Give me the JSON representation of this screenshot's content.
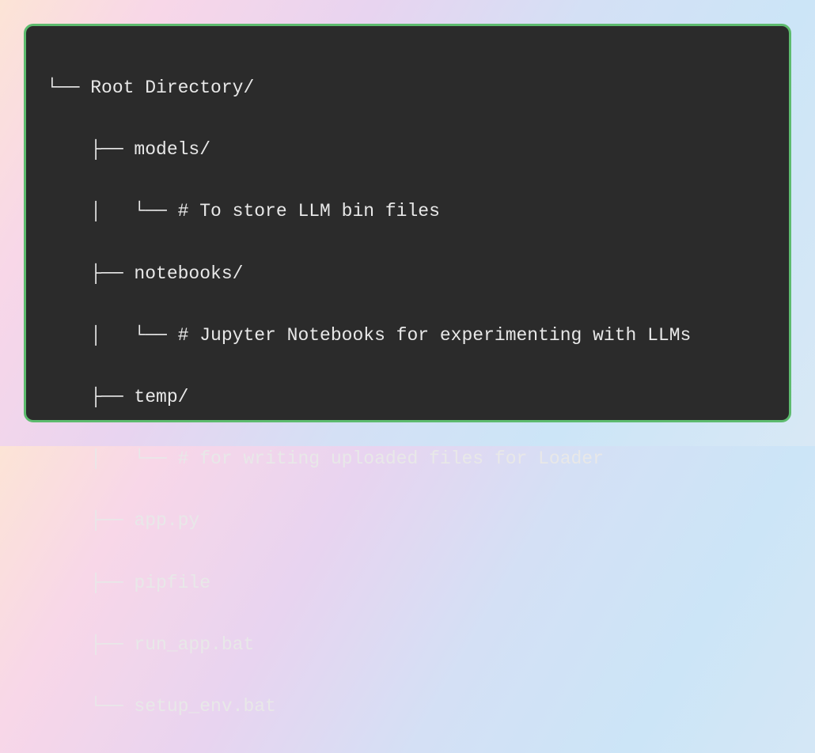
{
  "tree": {
    "lines": [
      "└── Root Directory/",
      "    ├── models/",
      "    │   └── # To store LLM bin files",
      "    ├── notebooks/",
      "    │   └── # Jupyter Notebooks for experimenting with LLMs",
      "    ├── temp/",
      "    │   └── # for writing uploaded files for Loader",
      "    ├── app.py",
      "    ├── pipfile",
      "    ├── run_app.bat",
      "    └── setup_env.bat"
    ]
  }
}
